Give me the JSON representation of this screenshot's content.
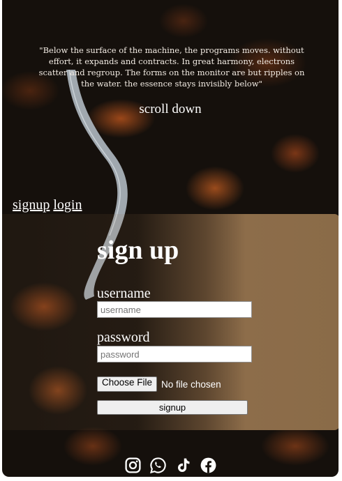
{
  "hero": {
    "quote": "\"Below the surface of the machine, the programs moves. without effort, it expands and contracts. In great harmony, electrons scatter and regroup. The forms on the monitor are but ripples on the water. the essence stays invisibly below\"",
    "scroll_label": "scroll down"
  },
  "nav": {
    "signup_label": "signup",
    "login_label": "login"
  },
  "form": {
    "title": "sign up",
    "username_label": "username",
    "username_placeholder": "username",
    "username_value": "",
    "password_label": "password",
    "password_placeholder": "password",
    "password_value": "",
    "file_button_label": "Choose File",
    "file_status": "No file chosen",
    "submit_label": "signup"
  },
  "footer": {
    "socials": [
      "instagram-icon",
      "whatsapp-icon",
      "tiktok-icon",
      "facebook-icon"
    ]
  },
  "colors": {
    "card_accent": "#8a6b48",
    "background": "#15100c",
    "text": "#ffffff"
  }
}
